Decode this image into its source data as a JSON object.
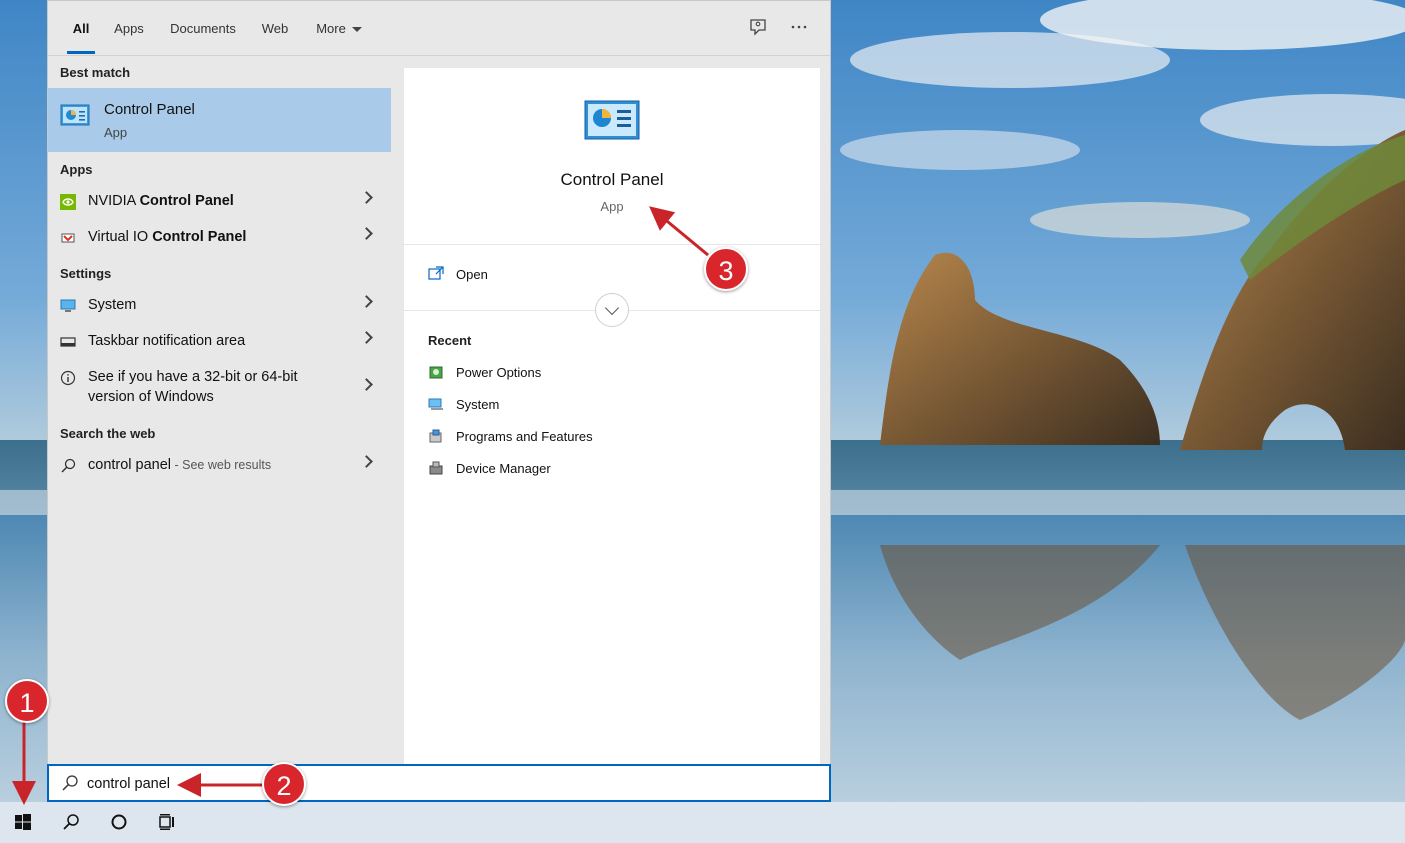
{
  "tabs": [
    {
      "label": "All"
    },
    {
      "label": "Apps"
    },
    {
      "label": "Documents"
    },
    {
      "label": "Web"
    },
    {
      "label": "More"
    }
  ],
  "toolbar": {
    "feedback_icon": "feedback-icon",
    "more_icon": "ellipsis-icon"
  },
  "left": {
    "best_match_header": "Best match",
    "best_match": {
      "title": "Control Panel",
      "subtitle": "App",
      "icon": "control-panel-icon"
    },
    "apps_header": "Apps",
    "apps": [
      {
        "prefix": "NVIDIA ",
        "bold": "Control Panel",
        "icon": "nvidia-icon"
      },
      {
        "prefix": "Virtual IO ",
        "bold": "Control Panel",
        "icon": "virtual-io-icon"
      }
    ],
    "settings_header": "Settings",
    "settings": [
      {
        "label": "System",
        "icon": "monitor-icon"
      },
      {
        "label": "Taskbar notification area",
        "icon": "taskbar-icon"
      },
      {
        "label_line1": "See if you have a 32-bit or 64-bit",
        "label_line2": "version of Windows",
        "icon": "info-icon"
      }
    ],
    "web_header": "Search the web",
    "web": {
      "query": "control panel",
      "hint": " - See web results",
      "icon": "search-icon"
    }
  },
  "right": {
    "title": "Control Panel",
    "subtitle": "App",
    "open_label": "Open",
    "recent_header": "Recent",
    "recent": [
      {
        "label": "Power Options",
        "icon": "power-options-icon"
      },
      {
        "label": "System",
        "icon": "system-icon"
      },
      {
        "label": "Programs and Features",
        "icon": "programs-icon"
      },
      {
        "label": "Device Manager",
        "icon": "device-manager-icon"
      }
    ]
  },
  "search": {
    "value": "control panel"
  },
  "taskbar": {
    "items": [
      "start-button",
      "search-button",
      "cortana-button",
      "task-view-button"
    ]
  },
  "annotations": [
    {
      "number": "1"
    },
    {
      "number": "2"
    },
    {
      "number": "3"
    }
  ],
  "colors": {
    "accent": "#0067c0",
    "selection": "#a9cbe9",
    "annotation": "#d9262c"
  }
}
